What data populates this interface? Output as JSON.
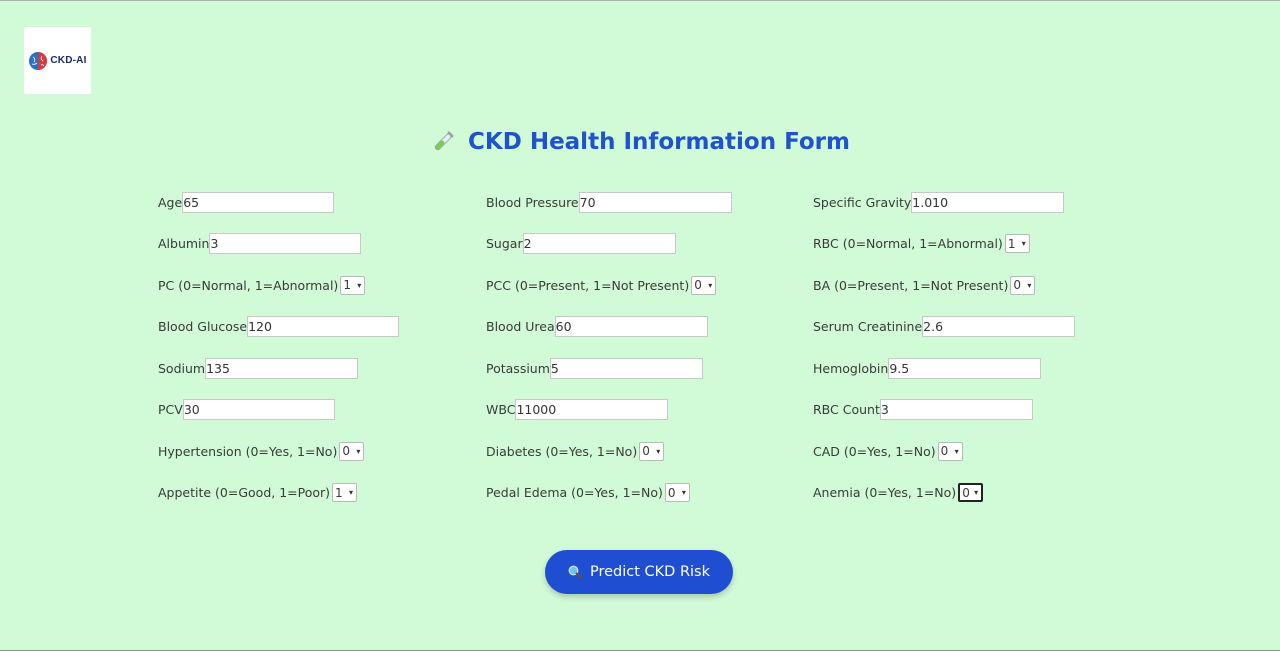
{
  "logo": {
    "text": "CKD-AI"
  },
  "header": {
    "title": "CKD Health Information Form"
  },
  "form": {
    "rows": [
      [
        {
          "label": "Age",
          "type": "input",
          "value": "65"
        },
        {
          "label": "Blood Pressure",
          "type": "input",
          "value": "70"
        },
        {
          "label": "Specific Gravity",
          "type": "input",
          "value": "1.010"
        }
      ],
      [
        {
          "label": "Albumin",
          "type": "input",
          "value": "3"
        },
        {
          "label": "Sugar",
          "type": "input",
          "value": "2"
        },
        {
          "label": "RBC (0=Normal, 1=Abnormal)",
          "type": "select",
          "value": "1"
        }
      ],
      [
        {
          "label": "PC (0=Normal, 1=Abnormal)",
          "type": "select",
          "value": "1"
        },
        {
          "label": "PCC (0=Present, 1=Not Present)",
          "type": "select",
          "value": "0"
        },
        {
          "label": "BA (0=Present, 1=Not Present)",
          "type": "select",
          "value": "0"
        }
      ],
      [
        {
          "label": "Blood Glucose",
          "type": "input",
          "value": "120"
        },
        {
          "label": "Blood Urea",
          "type": "input",
          "value": "60"
        },
        {
          "label": "Serum Creatinine",
          "type": "input",
          "value": "2.6"
        }
      ],
      [
        {
          "label": "Sodium",
          "type": "input",
          "value": "135"
        },
        {
          "label": "Potassium",
          "type": "input",
          "value": "5"
        },
        {
          "label": "Hemoglobin",
          "type": "input",
          "value": "9.5"
        }
      ],
      [
        {
          "label": "PCV",
          "type": "input",
          "value": "30"
        },
        {
          "label": "WBC",
          "type": "input",
          "value": "11000"
        },
        {
          "label": "RBC Count",
          "type": "input",
          "value": "3"
        }
      ],
      [
        {
          "label": "Hypertension (0=Yes, 1=No)",
          "type": "select",
          "value": "0"
        },
        {
          "label": "Diabetes (0=Yes, 1=No)",
          "type": "select",
          "value": "0"
        },
        {
          "label": "CAD (0=Yes, 1=No)",
          "type": "select",
          "value": "0"
        }
      ],
      [
        {
          "label": "Appetite (0=Good, 1=Poor)",
          "type": "select",
          "value": "1"
        },
        {
          "label": "Pedal Edema (0=Yes, 1=No)",
          "type": "select",
          "value": "0"
        },
        {
          "label": "Anemia (0=Yes, 1=No)",
          "type": "select",
          "value": "0",
          "focused": true
        }
      ]
    ]
  },
  "predict_button": {
    "label": "Predict CKD Risk",
    "icon": "search-icon"
  },
  "colors": {
    "background": "#d1fad7",
    "accent": "#1f4ed3",
    "title": "#1f53cc"
  }
}
